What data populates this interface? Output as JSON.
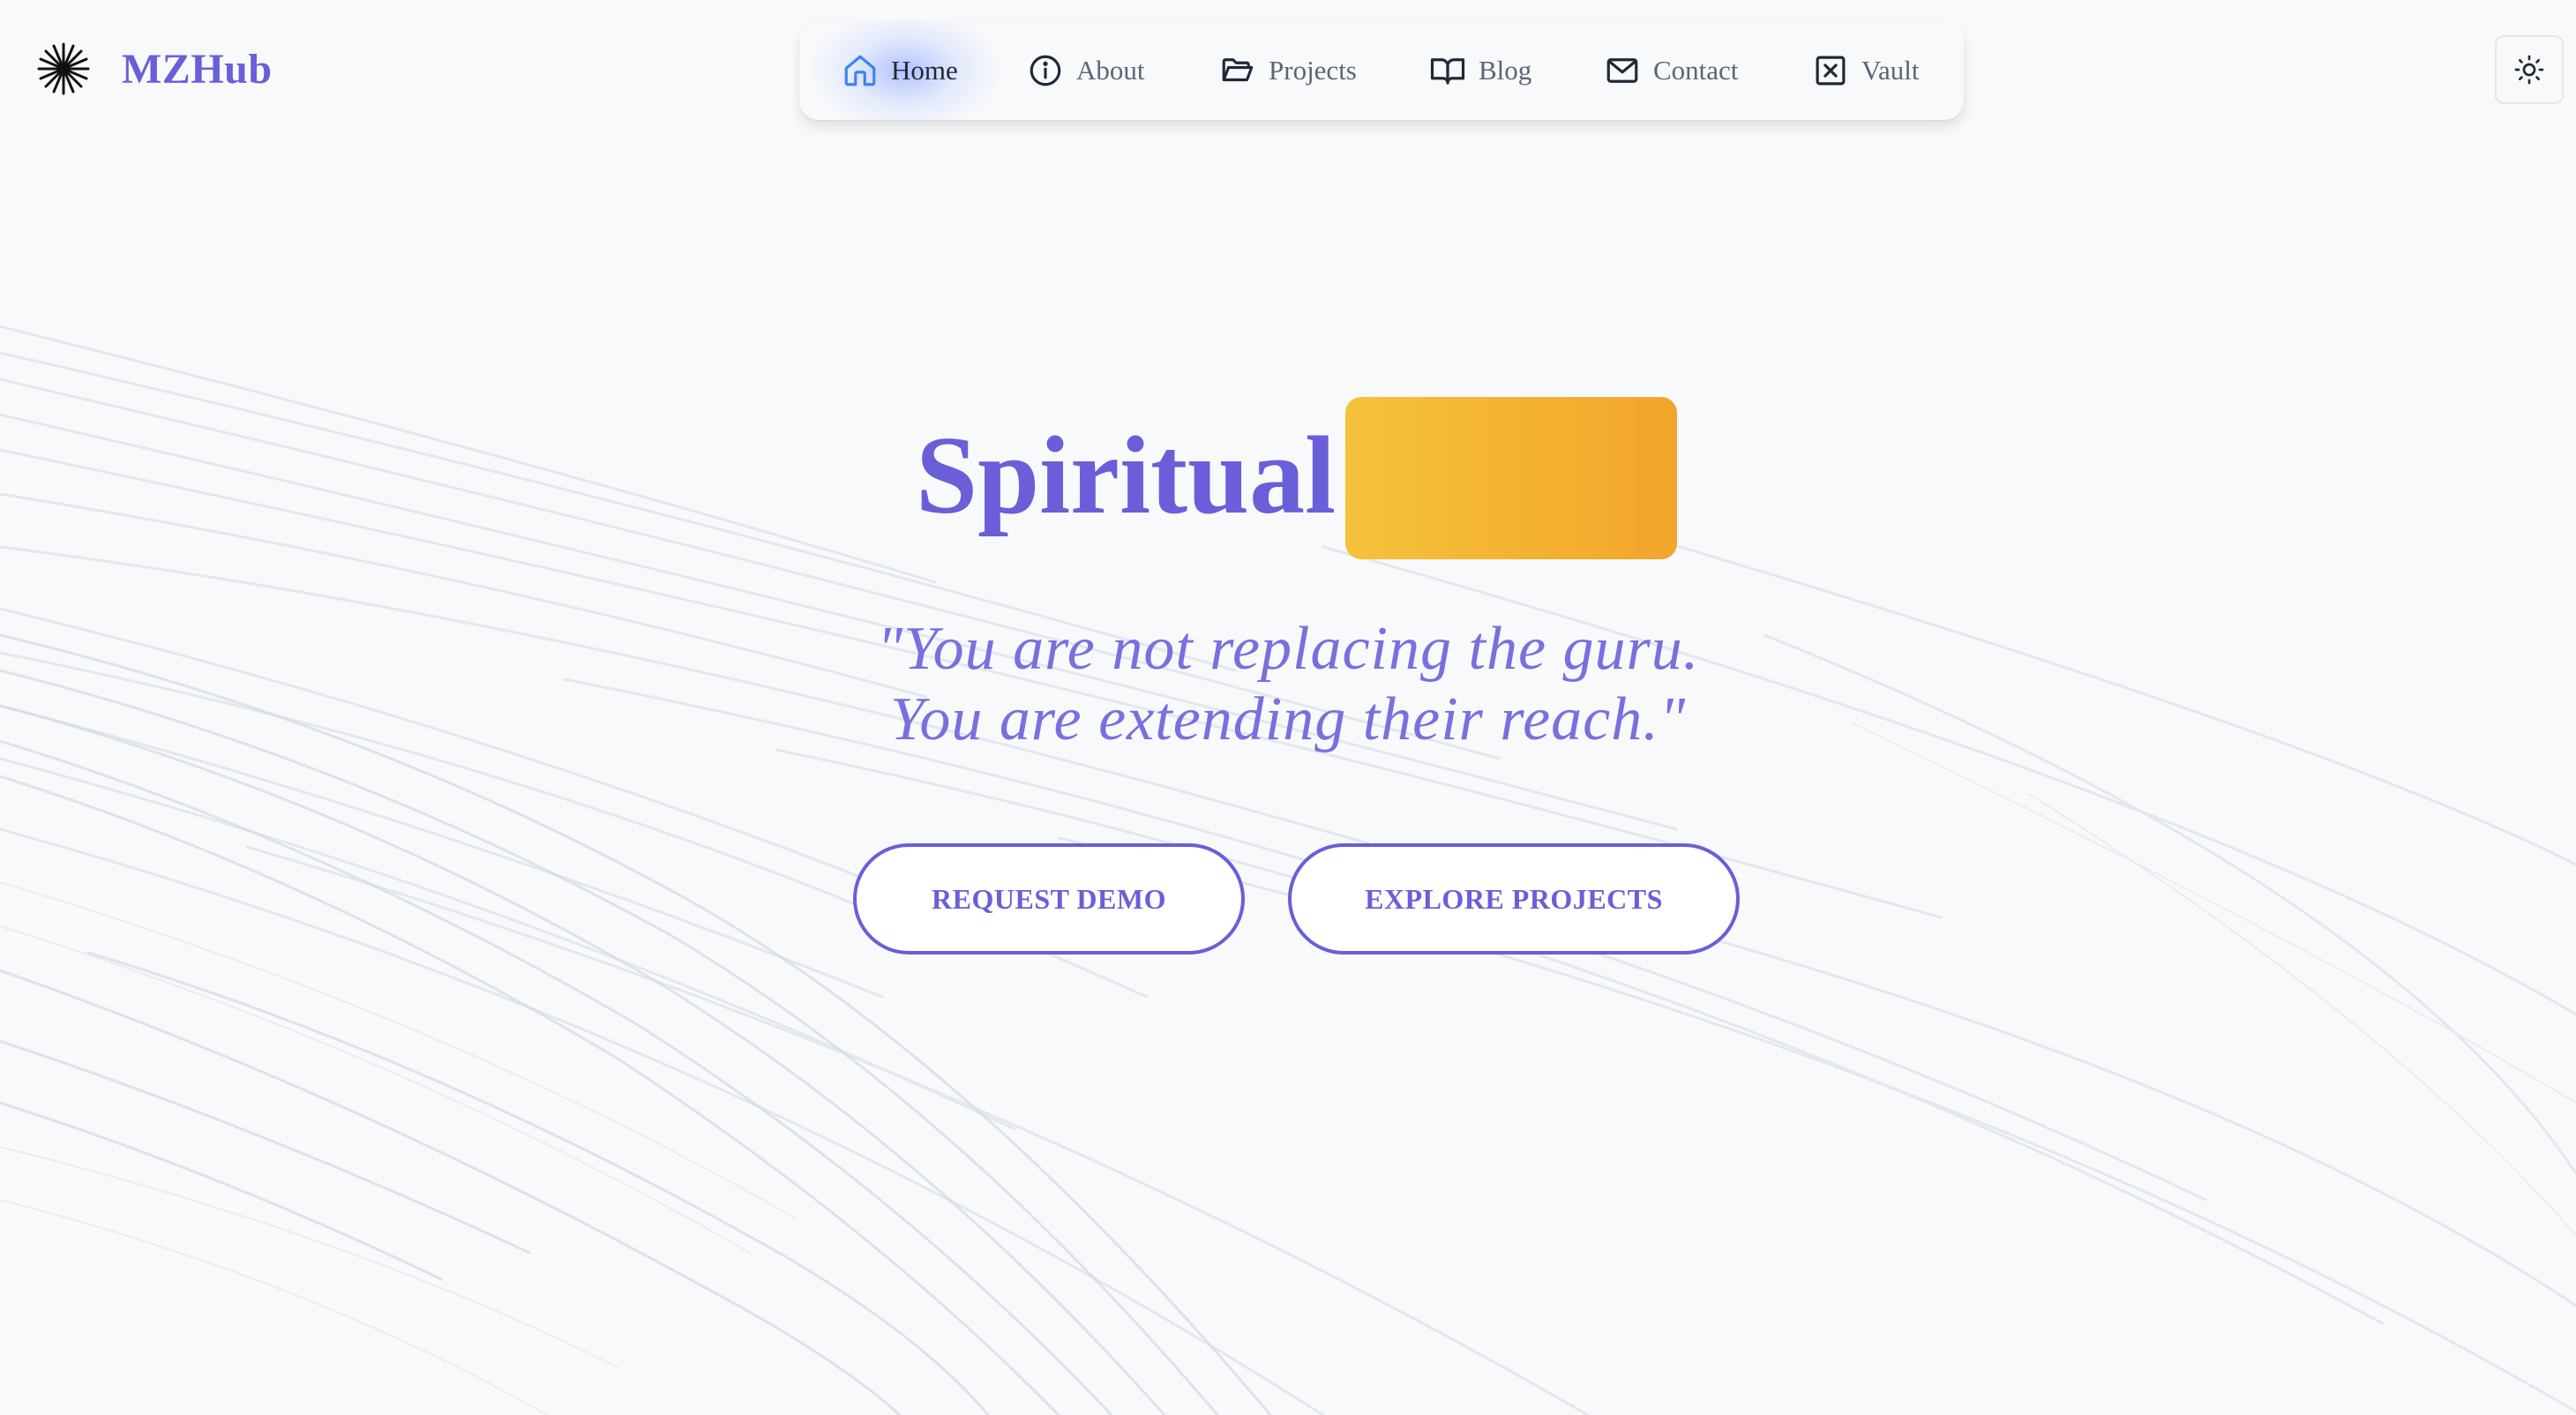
{
  "brand": {
    "name": "MZHub",
    "logo_icon": "starburst-icon"
  },
  "nav": {
    "items": [
      {
        "label": "Home",
        "icon": "home-icon",
        "active": true
      },
      {
        "label": "About",
        "icon": "info-icon",
        "active": false
      },
      {
        "label": "Projects",
        "icon": "folder-open-icon",
        "active": false
      },
      {
        "label": "Blog",
        "icon": "book-open-icon",
        "active": false
      },
      {
        "label": "Contact",
        "icon": "mail-icon",
        "active": false
      },
      {
        "label": "Vault",
        "icon": "vault-x-icon",
        "active": false
      }
    ]
  },
  "theme_toggle": {
    "icon": "sun-icon"
  },
  "hero": {
    "title": "Spiritual",
    "quote_line1": "\"You are not replacing the guru.",
    "quote_line2": "You are extending their reach.\"",
    "primary_cta": "REQUEST DEMO",
    "secondary_cta": "EXPLORE PROJECTS"
  },
  "colors": {
    "accent": "#6a5ed9",
    "accent_soft": "#7a6fde",
    "highlight_start": "#f6c23a",
    "highlight_end": "#f2a52c",
    "background": "#f8f9fb",
    "nav_text": "#5c6577"
  }
}
